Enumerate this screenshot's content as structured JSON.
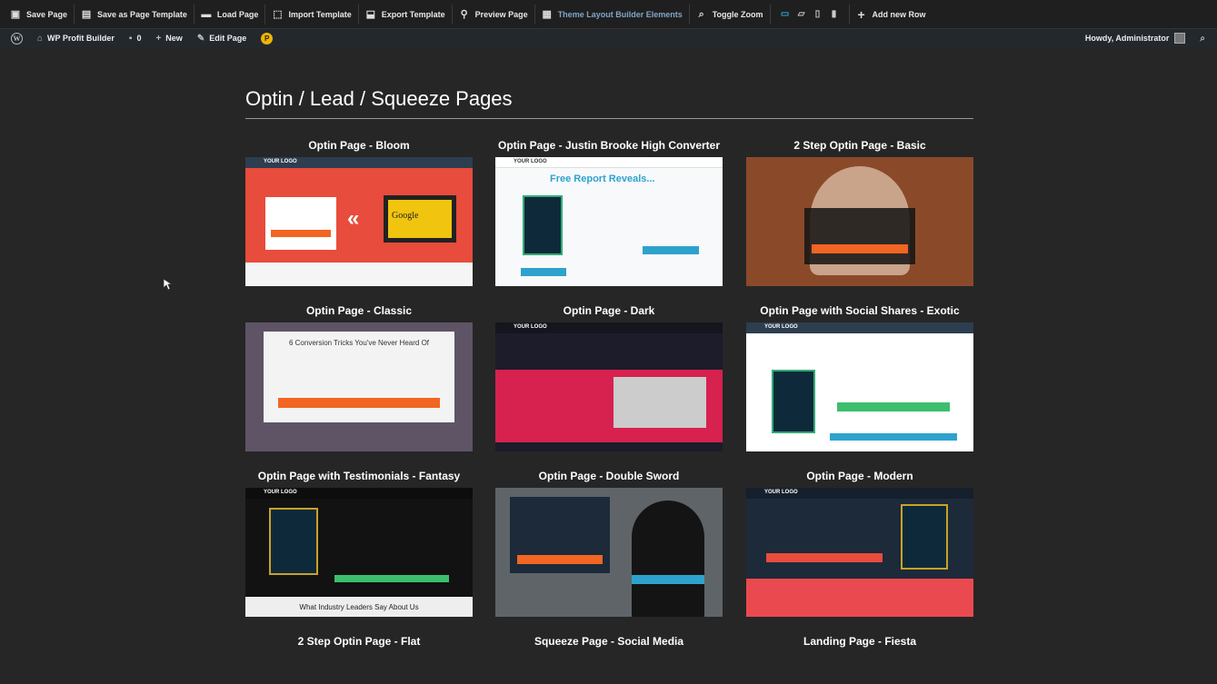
{
  "toolbar": {
    "save": "Save Page",
    "save_template": "Save as Page Template",
    "load": "Load Page",
    "import": "Import Template",
    "export": "Export Template",
    "preview": "Preview Page",
    "theme_builder": "Theme Layout Builder Elements",
    "toggle_zoom": "Toggle Zoom",
    "add_row": "Add new Row"
  },
  "adminbar": {
    "site": "WP Profit Builder",
    "comments": "0",
    "new": "New",
    "edit": "Edit Page",
    "howdy": "Howdy, Administrator"
  },
  "section_title": "Optin / Lead / Squeeze Pages",
  "templates": [
    {
      "title": "Optin Page - Bloom"
    },
    {
      "title": "Optin Page - Justin Brooke High Converter"
    },
    {
      "title": "2 Step Optin Page - Basic"
    },
    {
      "title": "Optin Page - Classic"
    },
    {
      "title": "Optin Page - Dark"
    },
    {
      "title": "Optin Page with Social Shares - Exotic"
    },
    {
      "title": "Optin Page with Testimonials - Fantasy"
    },
    {
      "title": "Optin Page - Double Sword"
    },
    {
      "title": "Optin Page - Modern"
    },
    {
      "title": "2 Step Optin Page - Flat"
    },
    {
      "title": "Squeeze Page - Social Media"
    },
    {
      "title": "Landing Page - Fiesta"
    }
  ],
  "thumb_text": {
    "logo": "YOUR LOGO",
    "google": "Google",
    "free_report": "Free Report Reveals...",
    "classic_heading": "6 Conversion Tricks You've Never Heard Of",
    "fantasy_footer": "What Industry Leaders Say About Us"
  },
  "colors": {
    "accent": "#2ea2cc",
    "bloom_red": "#e74c3c",
    "orange": "#f26522",
    "crimson": "#d7214f",
    "green": "#3bbf6e",
    "navy": "#1c2a3a"
  }
}
